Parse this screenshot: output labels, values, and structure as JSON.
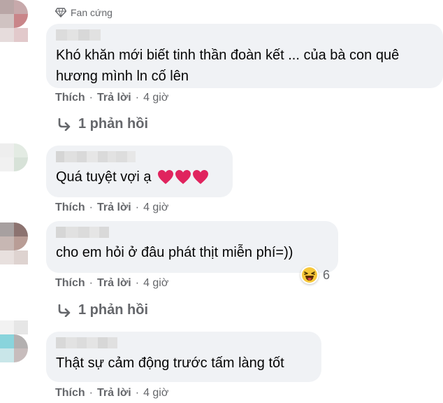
{
  "badge": {
    "label": "Fan cứng"
  },
  "labels": {
    "like": "Thích",
    "reply": "Trả lời",
    "dot": "·"
  },
  "comments": [
    {
      "text_line1": "Khó khăn mới biết tinh thần đoàn kết ... của bà con quê",
      "text_line2": "hương mình ln cố lên",
      "time": "4 giờ",
      "replies": "1 phản hồi"
    },
    {
      "text": "Quá tuyệt vợi ạ",
      "time": "4 giờ"
    },
    {
      "text": "cho em hỏi ở đâu phát thịt miễn phí=))",
      "time": "4 giờ",
      "reaction_count": "6",
      "replies": "1 phản hồi"
    },
    {
      "text": "Thật sự cảm động trước tấm làng tốt",
      "time": "4 giờ"
    }
  ],
  "colors": {
    "bubble": "#f0f2f5",
    "secondary_text": "#65676b",
    "text": "#050505",
    "heart": "#e0245e"
  },
  "icons": {
    "badge": "diamond-icon",
    "reply_arrow": "reply-arrow-icon",
    "heart": "heart-icon",
    "laugh": "laughing-emoji-icon"
  }
}
